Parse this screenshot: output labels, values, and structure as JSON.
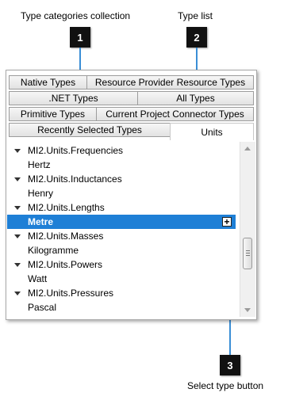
{
  "callouts": [
    {
      "number": "1",
      "label": "Type categories collection"
    },
    {
      "number": "2",
      "label": "Type list"
    },
    {
      "number": "3",
      "label": "Select type button"
    }
  ],
  "tabs": {
    "row1": [
      "Native Types",
      "Resource Provider Resource Types"
    ],
    "row2": [
      ".NET Types",
      "All Types"
    ],
    "row3": [
      "Primitive Types",
      "Current Project Connector Types"
    ],
    "row4": [
      "Recently Selected Types",
      "Units"
    ],
    "selected": "Units"
  },
  "type_list": [
    {
      "kind": "group",
      "label": "MI2.Units.Frequencies"
    },
    {
      "kind": "item",
      "label": "Hertz"
    },
    {
      "kind": "group",
      "label": "MI2.Units.Inductances"
    },
    {
      "kind": "item",
      "label": "Henry"
    },
    {
      "kind": "group",
      "label": "MI2.Units.Lengths"
    },
    {
      "kind": "item",
      "label": "Metre",
      "selected": true
    },
    {
      "kind": "group",
      "label": "MI2.Units.Masses"
    },
    {
      "kind": "item",
      "label": "Kilogramme"
    },
    {
      "kind": "group",
      "label": "MI2.Units.Powers"
    },
    {
      "kind": "item",
      "label": "Watt"
    },
    {
      "kind": "group",
      "label": "MI2.Units.Pressures"
    },
    {
      "kind": "item",
      "label": "Pascal"
    }
  ],
  "select_button": {
    "glyph": "+"
  },
  "colors": {
    "selection": "#1e7fd6",
    "callout_line": "#3a8ed6",
    "badge": "#111111"
  }
}
